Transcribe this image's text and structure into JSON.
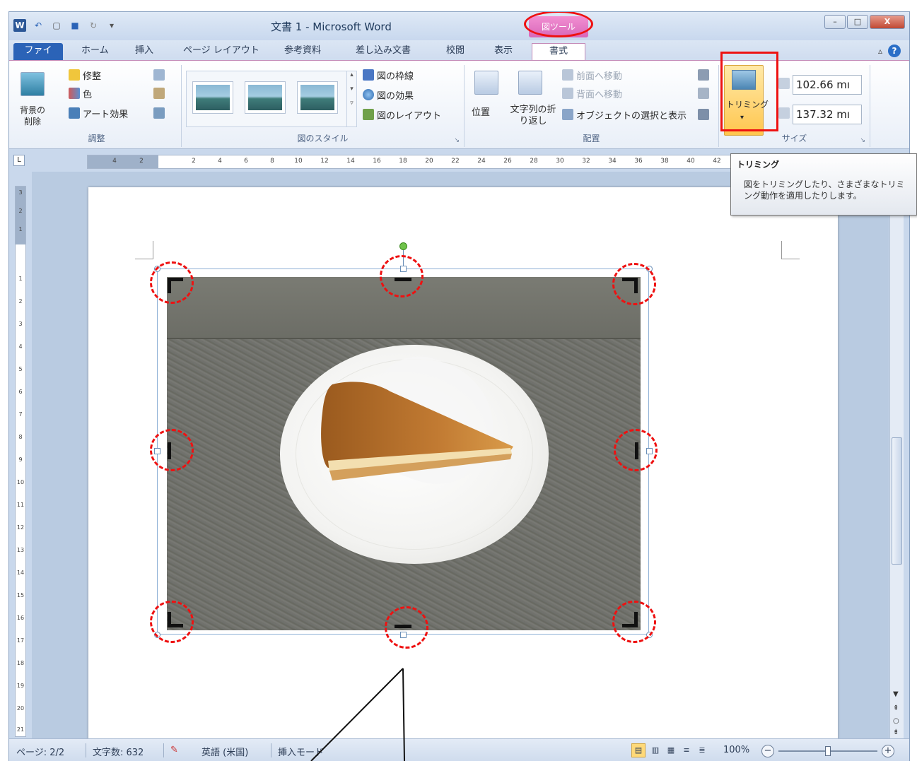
{
  "window": {
    "title": "文書 1 - Microsoft Word",
    "context_tab_label": "図ツール",
    "app_icon_letter": "W",
    "minimize": "–",
    "maximize": "□",
    "close": "X"
  },
  "tabs": [
    "ファイル",
    "ホーム",
    "挿入",
    "ページ レイアウト",
    "参考資料",
    "差し込み文書",
    "校閲",
    "表示",
    "書式"
  ],
  "ribbon": {
    "adjust_group": {
      "label": "調整",
      "remove_background": "背景の削除",
      "corrections": "修整",
      "color": "色",
      "artistic_effects": "アート効果"
    },
    "styles_group": {
      "label": "図のスタイル",
      "border": "図の枠線",
      "effects": "図の効果",
      "layout": "図のレイアウト"
    },
    "arrange_group": {
      "label": "配置",
      "position": "位置",
      "wrap_text": "文字列の折り返し",
      "bring_forward": "前面へ移動",
      "send_backward": "背面へ移動",
      "selection_pane": "オブジェクトの選択と表示"
    },
    "size_group": {
      "label": "サイズ",
      "crop": "トリミング",
      "height": "102.66 mı",
      "width": "137.32 mı"
    }
  },
  "tooltip": {
    "title": "トリミング",
    "body": "図をトリミングしたり、さまざまなトリミング動作を適用したりします。"
  },
  "ruler": {
    "horizontal": [
      "4",
      "2",
      "2",
      "4",
      "6",
      "8",
      "10",
      "12",
      "14",
      "16",
      "18",
      "20",
      "22",
      "24",
      "26",
      "28",
      "30",
      "32",
      "34",
      "36",
      "38",
      "40",
      "42"
    ],
    "vertical": [
      "3",
      "2",
      "1",
      "1",
      "2",
      "3",
      "4",
      "5",
      "6",
      "7",
      "8",
      "9",
      "10",
      "11",
      "12",
      "13",
      "14",
      "15",
      "16",
      "17",
      "18",
      "19",
      "20",
      "21"
    ],
    "tab_selector": "L"
  },
  "status": {
    "page": "ページ: 2/2",
    "words": "文字数: 632",
    "language": "英語 (米国)",
    "mode": "挿入モード",
    "zoom": "100%",
    "zoom_out": "−",
    "zoom_in": "+"
  },
  "colors": {
    "context_tab": "#d867b9",
    "highlight_red": "#ee1111",
    "file_tab": "#2b63b7"
  }
}
